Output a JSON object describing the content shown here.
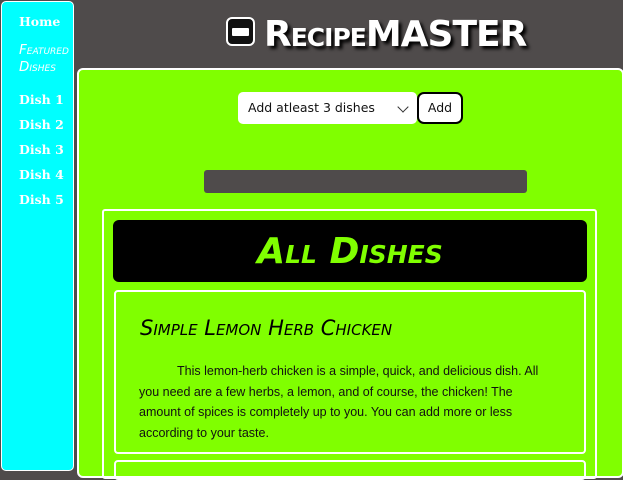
{
  "sidebar": {
    "home": "Home",
    "featured": "Featured Dishes",
    "items": [
      "Dish 1",
      "Dish 2",
      "Dish 3",
      "Dish 4",
      "Dish 5"
    ]
  },
  "header": {
    "logo_icon": "cookbook-logo-icon",
    "brand_recipe": "Recipe",
    "brand_master": "MASTER"
  },
  "controls": {
    "select_value": "Add atleast 3 dishes",
    "add_label": "Add"
  },
  "dishes": {
    "title": "All Dishes",
    "cards": [
      {
        "title": "Simple Lemon Herb Chicken",
        "text": "This lemon-herb chicken is a simple, quick, and delicious dish. All you need are a few herbs, a lemon, and of course, the chicken! The amount of spices is completely up to you. You can add more or less according to your taste."
      }
    ]
  },
  "colors": {
    "background": "#4f4b4b",
    "sidebar": "#00ffff",
    "main": "#80ff00",
    "header_bar": "#000000",
    "border": "#ffffff"
  }
}
